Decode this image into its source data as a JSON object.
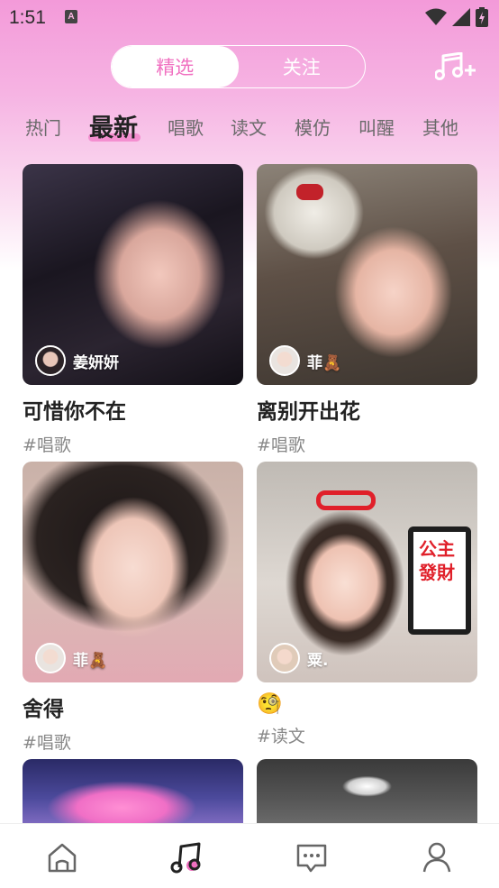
{
  "status": {
    "time": "1:51",
    "notif": "A"
  },
  "segment": {
    "items": [
      "精选",
      "关注"
    ]
  },
  "tabs": [
    "热门",
    "最新",
    "唱歌",
    "读文",
    "模仿",
    "叫醒",
    "其他"
  ],
  "cards": [
    {
      "user": "姜妍妍",
      "title": "可惜你不在",
      "tag": "#唱歌"
    },
    {
      "user": "菲🧸",
      "title": "离别开出花",
      "tag": "#唱歌"
    },
    {
      "user": "菲🧸",
      "title": "舍得",
      "tag": "#唱歌"
    },
    {
      "user": "粟.",
      "title": "🧐",
      "tag": "#读文"
    }
  ],
  "colors": {
    "accent": "#f06fc0",
    "header": "#f39ad9"
  },
  "icons": {
    "nav": [
      "home-icon",
      "music-icon",
      "message-icon",
      "profile-icon"
    ],
    "top": "music-add-icon"
  }
}
